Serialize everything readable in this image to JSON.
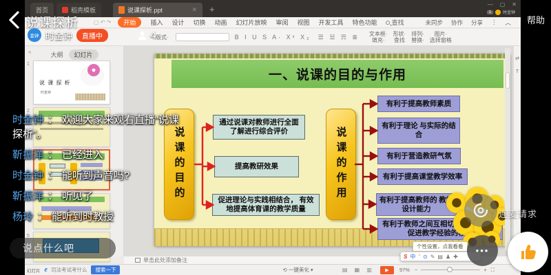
{
  "overlay": {
    "title": "说课探析",
    "help": "帮助",
    "host": {
      "avatar_label": "金钟",
      "name": "时金钟",
      "live_badge": "直播中",
      "viewer_count": "4"
    },
    "chat_sep": "：",
    "chat": [
      {
        "name": "时金钟",
        "text": "欢迎大家来观看直播“说课探析”。"
      },
      {
        "name": "靳振洋",
        "text": "已经进入"
      },
      {
        "name": "时金钟",
        "text": "能听到声音吗?"
      },
      {
        "name": "靳振洋",
        "text": "听见了"
      },
      {
        "name": "杨玲",
        "text": "能听到时教授"
      }
    ],
    "input_placeholder": "说点什么吧",
    "mic_request": "连麦请求",
    "more_dots": "•••"
  },
  "wps": {
    "titlebar": {
      "home_tab": "首页",
      "template_tab": "稻壳模板",
      "doc_tab": "说课探析.ppt",
      "close_glyph": "✕",
      "new_tab": "+",
      "min_glyph": "—",
      "max_glyph": "▢",
      "winclose_glyph": "✕",
      "badge": "1",
      "account": "时金钟"
    },
    "ribbon": {
      "quick": "▢ ↶ ↷",
      "tabs": [
        "开始",
        "插入",
        "设计",
        "切换",
        "动画",
        "幻灯片放映",
        "审阅",
        "视图",
        "开发工具",
        "特色功能"
      ],
      "search": "查找",
      "sync": "未同步",
      "collab": "协作",
      "share": "分享",
      "more_glyph": "⋮",
      "collapse_glyph": "︿"
    },
    "toolbar": {
      "layout": "版式·",
      "format_glyphs": "B I U S A· Xˣ X₂",
      "lists_glyphs": "☰ ☱ ☴ ≣",
      "textbox": "文本框·",
      "shape": "形状·",
      "arrange": "排列·",
      "picture": "图片·",
      "fill": "填充·",
      "find": "查找",
      "replace": "替换·",
      "selectpane": "选择窗格"
    },
    "sidebar": {
      "collapse_glyph": "«",
      "outline_tab": "大纲",
      "slides_tab": "幻灯片",
      "numbers": [
        "1",
        "2",
        "3",
        "4",
        "5"
      ],
      "slide1_title": "说 课 探 析",
      "slide1_author": "时金钟",
      "add_slide": "+"
    },
    "notes": "单击此处添加备注",
    "status": {
      "slide_label": "幻灯片",
      "ie_glyph": "e",
      "ie_query": "司法考试考什么",
      "search_btn": "搜索一下",
      "beautify": "⟲ 一键美化 ▾",
      "view_glyphs": "▤ ▦ ▥",
      "play_glyph": "▶",
      "zoom": "97%",
      "minus": "−",
      "plus": "+",
      "fit_glyph": "⛶"
    },
    "tooltip": "个性设置，点我看看",
    "sogou": [
      "S",
      "中",
      "”",
      "⊙",
      "✎",
      "▤",
      "♟",
      "✚"
    ],
    "right_strip": [
      "⇄",
      "T"
    ]
  },
  "slide": {
    "title": "一、说课的目的与作用",
    "purpose_header": "说课的目的",
    "function_header": "说课的作用",
    "purposes": [
      "通过说课对教师进行全面 了解进行综合评价",
      "提高教研效果",
      "促进理论与实践相结合， 有效地提高体育课的教学质量"
    ],
    "functions": [
      "有利于提高教师素质",
      "有利于理论 与实际的结合",
      "有利于营造教研气氛",
      "有利于提高课堂教学效率",
      "有利于提高教师的 教学设计能力",
      "有利于教师之间互相切磋教学技艺， 促进教学经验的移植"
    ]
  },
  "colors": {
    "live_badge": "#f34f23",
    "chat_name_blue": "#55a0e8",
    "wps_accent_orange": "#ff6e26",
    "banner_green": "#7ec15e",
    "gold": "#f2b705",
    "teal_box": "#cbe0d8",
    "purple_box": "#9e9ed6",
    "arrow_red": "#e02121",
    "arrow_dark_red": "#9b0f0f",
    "search_blue": "#3b78d8",
    "like_thumb_orange": "#f7a21b"
  }
}
